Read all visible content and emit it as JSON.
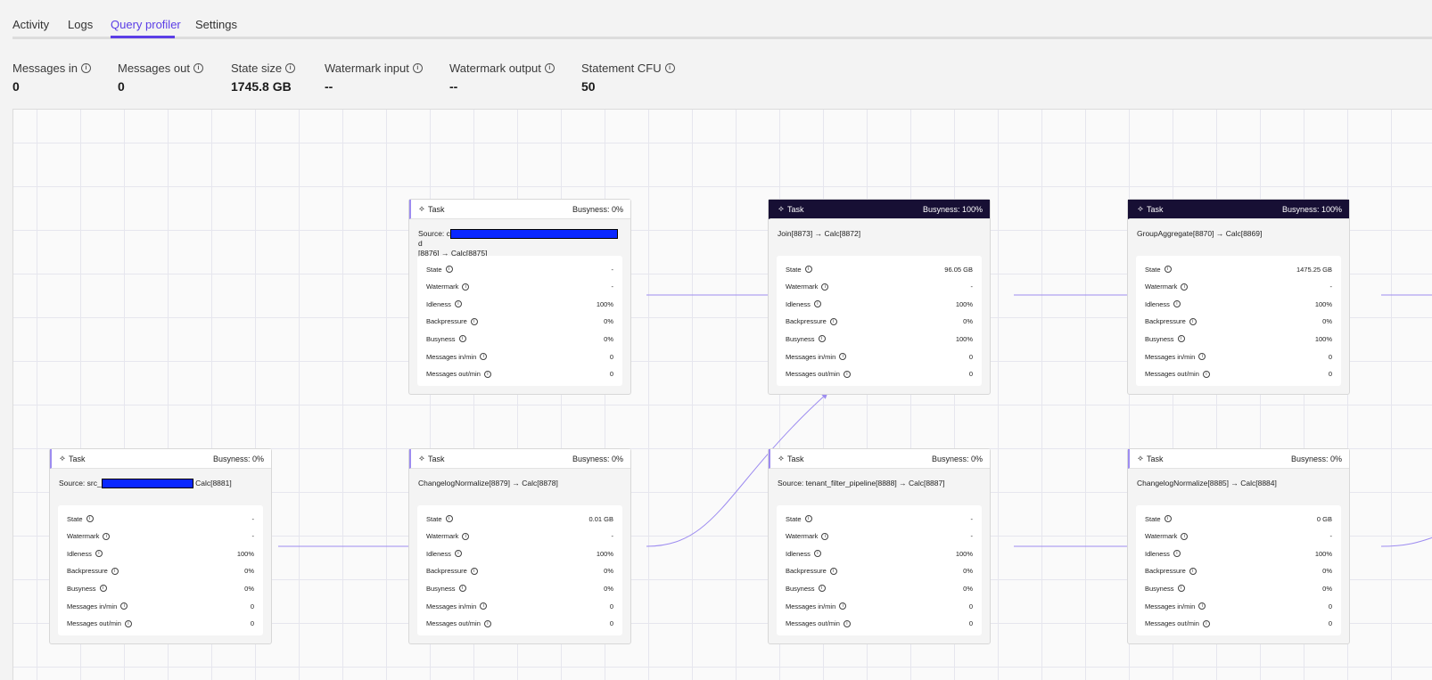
{
  "tabs": [
    {
      "label": "Activity"
    },
    {
      "label": "Logs"
    },
    {
      "label": "Query profiler"
    },
    {
      "label": "Settings"
    }
  ],
  "active_tab": "Query profiler",
  "metrics": [
    {
      "label": "Messages in",
      "value": "0"
    },
    {
      "label": "Messages out",
      "value": "0"
    },
    {
      "label": "State size",
      "value": "1745.8 GB"
    },
    {
      "label": "Watermark input",
      "value": "--"
    },
    {
      "label": "Watermark output",
      "value": "--"
    },
    {
      "label": "Statement CFU",
      "value": "50"
    }
  ],
  "colors": {
    "accent": "#5b3ee6",
    "busy_header": "#170f34",
    "edge": "#9d8cf0",
    "redaction": "#0a28ff"
  },
  "stat_labels": [
    "State",
    "Watermark",
    "Idleness",
    "Backpressure",
    "Busyness",
    "Messages in/min",
    "Messages out/min"
  ],
  "tasks": [
    {
      "header": "Task",
      "busyness": "Busyness: 0%",
      "busy": false,
      "name_prefix": "Source: c",
      "name_suffix": "d",
      "name_line2": "[8876] → Calc[8875]",
      "redacted": true,
      "values": [
        "-",
        "-",
        "100%",
        "0%",
        "0%",
        "0",
        "0"
      ]
    },
    {
      "header": "Task",
      "busyness": "Busyness: 100%",
      "busy": true,
      "name": "Join[8873] → Calc[8872]",
      "values": [
        "96.05 GB",
        "-",
        "100%",
        "0%",
        "100%",
        "0",
        "0"
      ]
    },
    {
      "header": "Task",
      "busyness": "Busyness: 100%",
      "busy": true,
      "name": "GroupAggregate[8870] → Calc[8869]",
      "values": [
        "1475.25 GB",
        "-",
        "100%",
        "0%",
        "100%",
        "0",
        "0"
      ]
    },
    {
      "header": "Task",
      "busyness": "Busyness: 0%",
      "busy": false,
      "name_prefix": "Source: src_",
      "name_suffix": " Calc[8881]",
      "redacted": true,
      "values": [
        "-",
        "-",
        "100%",
        "0%",
        "0%",
        "0",
        "0"
      ]
    },
    {
      "header": "Task",
      "busyness": "Busyness: 0%",
      "busy": false,
      "name": "ChangelogNormalize[8879] → Calc[8878]",
      "values": [
        "0.01 GB",
        "-",
        "100%",
        "0%",
        "0%",
        "0",
        "0"
      ]
    },
    {
      "header": "Task",
      "busyness": "Busyness: 0%",
      "busy": false,
      "name": "Source: tenant_filter_pipeline[8888] → Calc[8887]",
      "values": [
        "-",
        "-",
        "100%",
        "0%",
        "0%",
        "0",
        "0"
      ]
    },
    {
      "header": "Task",
      "busyness": "Busyness: 0%",
      "busy": false,
      "name": "ChangelogNormalize[8885] → Calc[8884]",
      "values": [
        "0 GB",
        "-",
        "100%",
        "0%",
        "0%",
        "0",
        "0"
      ]
    }
  ]
}
